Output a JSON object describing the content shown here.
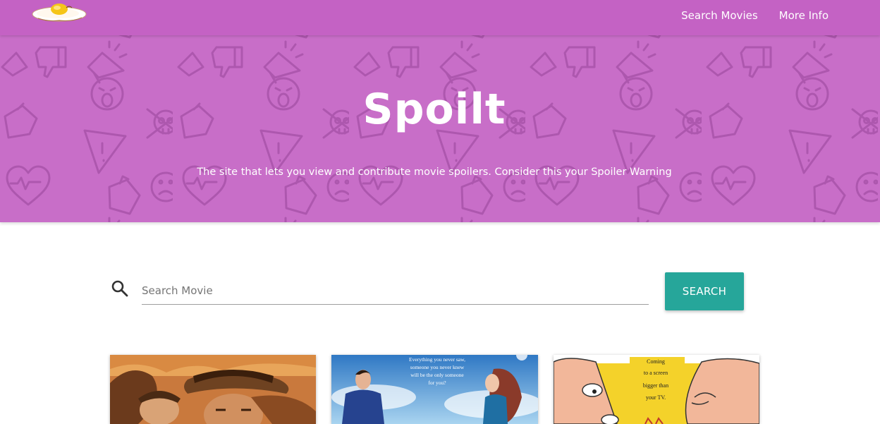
{
  "nav": {
    "links": [
      {
        "label": "Search Movies"
      },
      {
        "label": "More Info"
      }
    ]
  },
  "hero": {
    "title": "Spoilt",
    "subtitle": "The site that lets you view and contribute movie spoilers. Consider this your Spoiler Warning"
  },
  "search": {
    "placeholder": "Search Movie",
    "value": "",
    "button_label": "SEARCH"
  },
  "movies": [
    {
      "poster_lines": []
    },
    {
      "poster_lines": [
        "Everything you never saw,",
        "someone you never knew",
        "will be the only someone",
        "for you?"
      ]
    },
    {
      "poster_lines": [
        "Coming",
        "to a screen",
        "bigger than",
        "your TV."
      ]
    }
  ],
  "colors": {
    "navbar": "#c462c4",
    "hero": "#c86ec8",
    "button": "#26a69a"
  }
}
